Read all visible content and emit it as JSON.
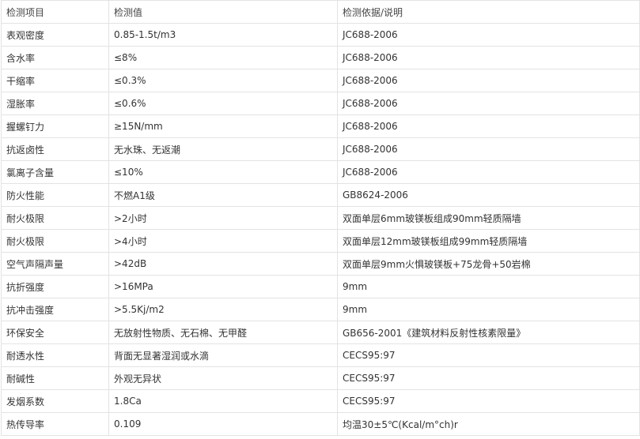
{
  "table": {
    "headers": [
      "检测项目",
      "检测值",
      "检测依据/说明"
    ],
    "rows": [
      [
        "表观密度",
        "0.85-1.5t/m3",
        "JC688-2006"
      ],
      [
        "含水率",
        "≤8%",
        "JC688-2006"
      ],
      [
        "干缩率",
        "≤0.3%",
        "JC688-2006"
      ],
      [
        "湿胀率",
        "≤0.6%",
        "JC688-2006"
      ],
      [
        "握螺钉力",
        "≥15N/mm",
        "JC688-2006"
      ],
      [
        "抗返卤性",
        "无水珠、无返潮",
        "JC688-2006"
      ],
      [
        "氯离子含量",
        "≤10%",
        "JC688-2006"
      ],
      [
        "防火性能",
        "不燃A1级",
        "GB8624-2006"
      ],
      [
        "耐火极限",
        ">2小时",
        "双面单层6mm玻镁板组成90mm轻质隔墙"
      ],
      [
        "耐火极限",
        ">4小时",
        "双面单层12mm玻镁板组成99mm轻质隔墙"
      ],
      [
        "空气声隔声量",
        ">42dB",
        "双面单层9mm火惧玻镁板+75龙骨+50岩棉"
      ],
      [
        "抗折强度",
        ">16MPa",
        "9mm"
      ],
      [
        "抗冲击强度",
        ">5.5Kj/m2",
        "9mm"
      ],
      [
        "环保安全",
        "无放射性物质、无石棉、无甲醛",
        "GB656-2001《建筑材料反射性核素限量》"
      ],
      [
        "耐透水性",
        "背面无显著湿润或水滴",
        "CECS95:97"
      ],
      [
        "耐碱性",
        "外观无异状",
        "CECS95:97"
      ],
      [
        "发烟系数",
        "1.8Ca",
        "CECS95:97"
      ],
      [
        "热传导率",
        "0.109",
        "均温30±5℃(Kcal/m°ch)r"
      ]
    ]
  }
}
